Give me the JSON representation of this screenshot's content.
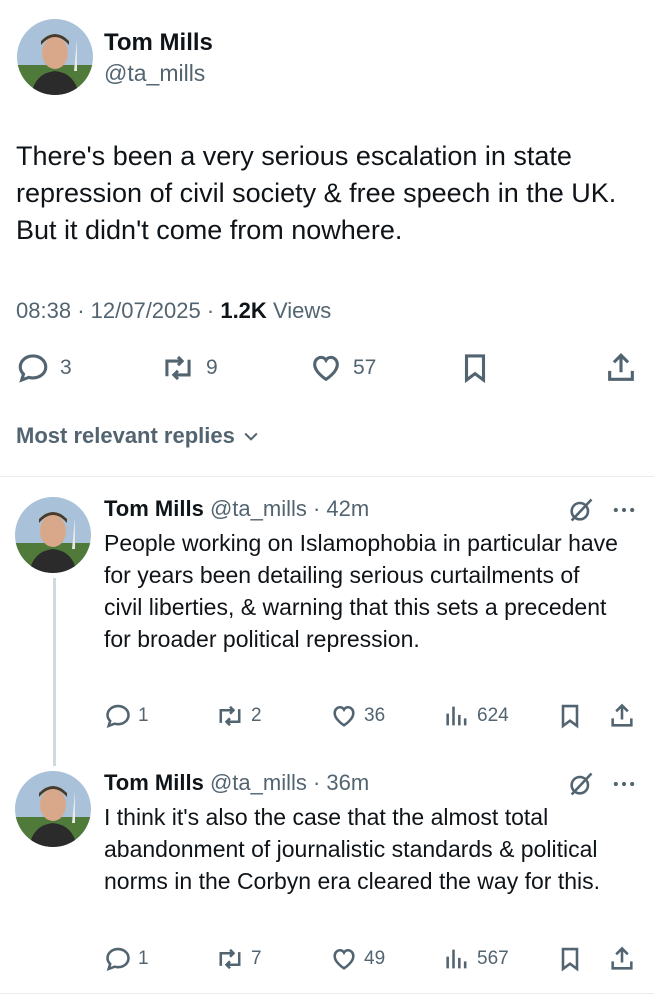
{
  "tweet": {
    "author_name": "Tom Mills",
    "author_handle": "@ta_mills",
    "text": "There's been a very serious escalation in state repression of civil society & free speech in the UK. But it didn't come from nowhere.",
    "time": "08:38",
    "date": "12/07/2025",
    "views_count": "1.2K",
    "views_label": "Views",
    "replies": "3",
    "reposts": "9",
    "likes": "57"
  },
  "replies_filter": {
    "label": "Most relevant replies"
  },
  "replies": [
    {
      "author_name": "Tom Mills",
      "author_handle": "@ta_mills",
      "age": "42m",
      "text": "People working on Islamophobia in particular have for years been detailing serious curtailments of civil liberties, & warning that this sets a precedent for broader political repression.",
      "replies": "1",
      "reposts": "2",
      "likes": "36",
      "views": "624"
    },
    {
      "author_name": "Tom Mills",
      "author_handle": "@ta_mills",
      "age": "36m",
      "text": "I think it's also the case that the almost total abandonment of journalistic standards & political norms in the Corbyn era cleared the way for this.",
      "replies": "1",
      "reposts": "7",
      "likes": "49",
      "views": "567"
    }
  ],
  "colors": {
    "text": "#0f1419",
    "muted": "#536471",
    "divider": "#e6ecf0"
  },
  "icons": [
    "reply-icon",
    "repost-icon",
    "like-icon",
    "bookmark-icon",
    "share-icon",
    "views-icon",
    "grok-icon",
    "more-icon",
    "chevron-down-icon"
  ]
}
